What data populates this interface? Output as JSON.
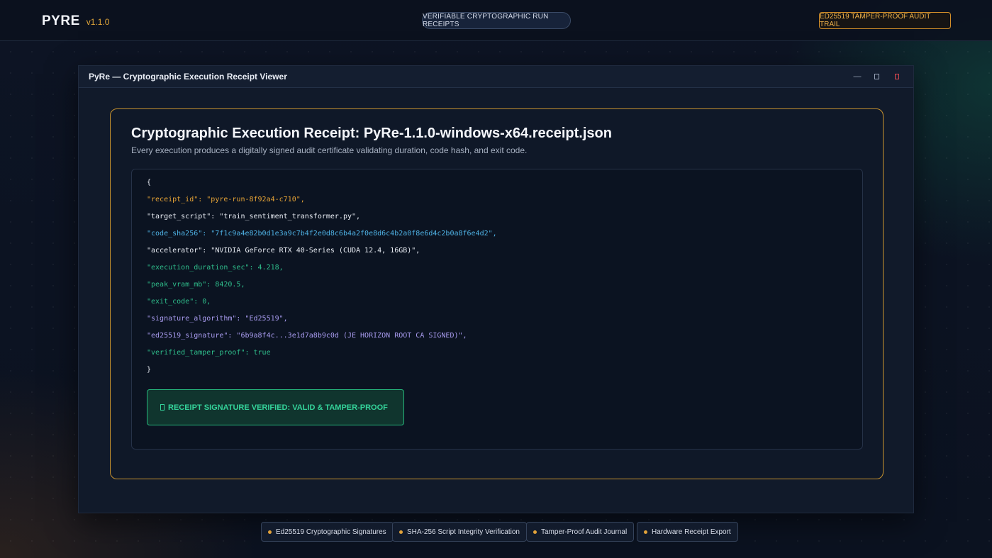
{
  "topbar": {
    "brand": "PYRE",
    "version": "v1.1.0",
    "tagline": "VERIFIABLE CRYPTOGRAPHIC RUN RECEIPTS",
    "audit_badge": "ED25519 TAMPER-PROOF AUDIT TRAIL"
  },
  "window": {
    "title": "PyRe — Cryptographic Execution Receipt Viewer",
    "controls": {
      "minimize": "—"
    }
  },
  "receipt": {
    "title": "Cryptographic Execution Receipt: PyRe-1.1.0-windows-x64.receipt.json",
    "subtitle": "Every execution produces a digitally signed audit certificate validating duration, code hash, and exit code.",
    "lines": [
      "{",
      "\"receipt_id\": \"pyre-run-8f92a4-c710\",",
      "\"target_script\": \"train_sentiment_transformer.py\",",
      "\"code_sha256\": \"7f1c9a4e82b0d1e3a9c7b4f2e0d8c6b4a2f0e8d6c4b2a0f8e6d4c2b0a8f6e4d2\",",
      "\"accelerator\": \"NVIDIA GeForce RTX 40-Series (CUDA 12.4, 16GB)\",",
      "\"execution_duration_sec\": 4.218,",
      "\"peak_vram_mb\": 8420.5,",
      "\"exit_code\": 0,",
      "\"signature_algorithm\": \"Ed25519\",",
      "\"ed25519_signature\": \"6b9a8f4c...3e1d7a8b9c0d (JE HORIZON ROOT CA SIGNED)\",",
      "\"verified_tamper_proof\": true",
      "}"
    ],
    "verification": "RECEIPT SIGNATURE VERIFIED: VALID & TAMPER-PROOF"
  },
  "features": [
    "Ed25519 Cryptographic Signatures",
    "SHA-256 Script Integrity Verification",
    "Tamper-Proof Audit Journal",
    "Hardware Receipt Export"
  ],
  "colors": {
    "accent_gold": "#c7922e",
    "verified_green": "#34d39a",
    "close_red": "#e0474f"
  }
}
